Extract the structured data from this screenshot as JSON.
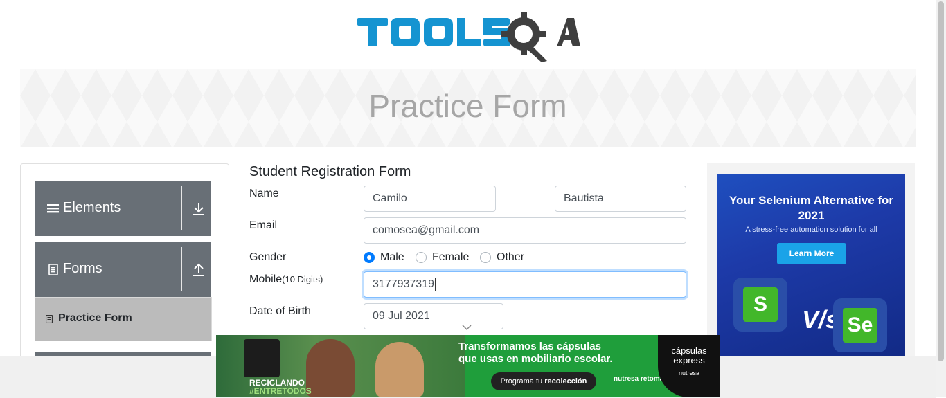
{
  "logo": {
    "text": "TOOLSQA"
  },
  "banner": {
    "title": "Practice Form"
  },
  "sidebar": {
    "groups": [
      {
        "label": "Elements"
      },
      {
        "label": "Forms"
      }
    ],
    "active_item": {
      "label": "Practice Form"
    }
  },
  "form": {
    "title": "Student Registration Form",
    "name_label": "Name",
    "first_name": "Camilo",
    "last_name": "Bautista",
    "email_label": "Email",
    "email": "comosea@gmail.com",
    "gender_label": "Gender",
    "gender_options": [
      "Male",
      "Female",
      "Other"
    ],
    "gender_selected": "Male",
    "mobile_label": "Mobile",
    "mobile_hint": "(10 Digits)",
    "mobile": "3177937319",
    "dob_label": "Date of Birth",
    "dob": "09 Jul 2021"
  },
  "right_ad": {
    "headline": "Your Selenium Alternative for 2021",
    "sub": "A stress-free automation solution for all",
    "button": "Learn More",
    "vs": "V/s",
    "left_tile": "S",
    "right_tile": "Se"
  },
  "bottom_ad": {
    "headline_line1": "Transformamos las cápsulas",
    "headline_line2": "que usas en mobiliario escolar.",
    "cta_prefix": "Programa tu ",
    "cta_bold": "recolección",
    "tag_line1": "RECICLANDO",
    "tag_line2": "#ENTRETODOS",
    "brand": "nutresa retoma",
    "capsulas": "cápsulas express",
    "capsulas_sub": "nutresa"
  },
  "colors": {
    "accent": "#007bff",
    "sidebar_header": "#686f76",
    "active_item": "#bbbbbb",
    "logo_blue": "#1594d1",
    "logo_dark": "#3f3f3f"
  }
}
